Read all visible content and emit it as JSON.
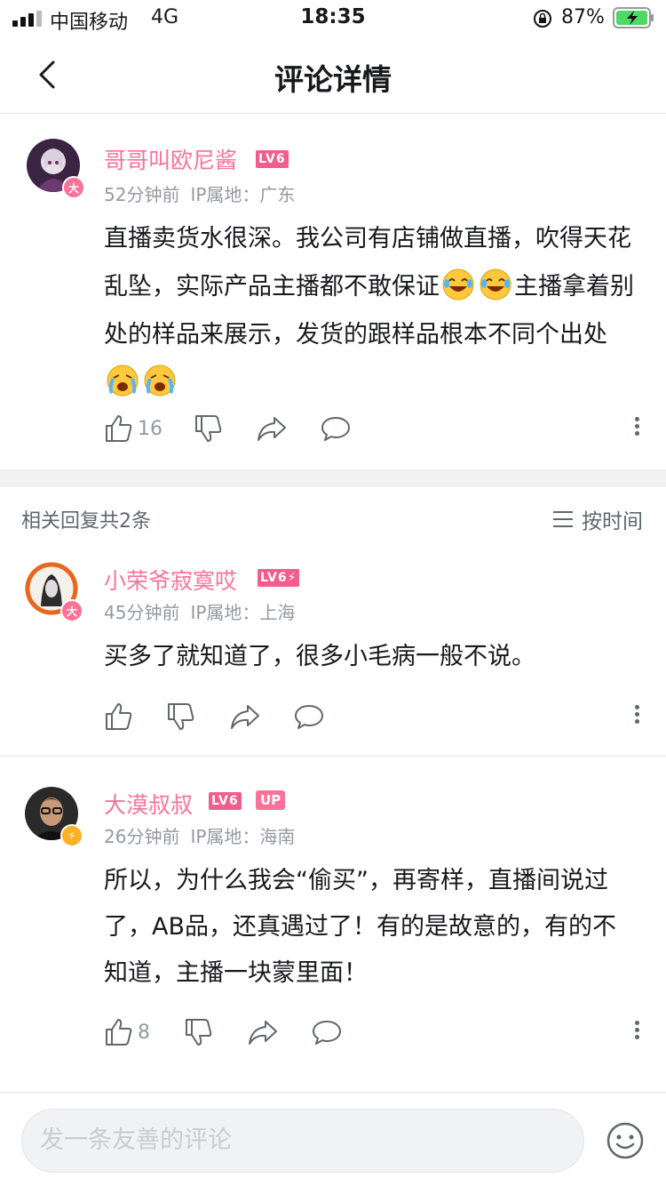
{
  "status_bar": {
    "carrier": "中国移动",
    "network": "4G",
    "time": "18:35",
    "battery": "87%"
  },
  "nav": {
    "title": "评论详情"
  },
  "main_comment": {
    "username": "哥哥叫欧尼酱",
    "level": "LV6",
    "badge": "大",
    "time": "52分钟前",
    "ip": "IP属地：广东",
    "text_1": "直播卖货水很深。我公司有店铺做直播，吹得天花乱坠，实际产品主播都不敢保证",
    "text_2": "主播拿着别处的样品来展示，发货的跟样品根本不同个出处",
    "likes": "16"
  },
  "reply_header": {
    "count_label": "相关回复共2条",
    "sort_label": "按时间"
  },
  "replies": [
    {
      "username": "小荣爷寂寞哎",
      "level": "LV6",
      "badge": "大",
      "time": "45分钟前",
      "ip": "IP属地：上海",
      "text": "买多了就知道了，很多小毛病一般不说。",
      "likes": ""
    },
    {
      "username": "大漠叔叔",
      "level": "LV6",
      "up_badge": "UP",
      "time": "26分钟前",
      "ip": "IP属地：海南",
      "text": "所以，为什么我会“偷买”，再寄样，直播间说过了，AB品，还真遇过了！有的是故意的，有的不知道，主播一块蒙里面！",
      "likes": "8"
    }
  ],
  "bottom_bar": {
    "placeholder": "发一条友善的评论"
  },
  "colors": {
    "accent": "#fb7299",
    "level": "#f25d8e",
    "meta": "#9499a0",
    "text": "#18191c"
  }
}
